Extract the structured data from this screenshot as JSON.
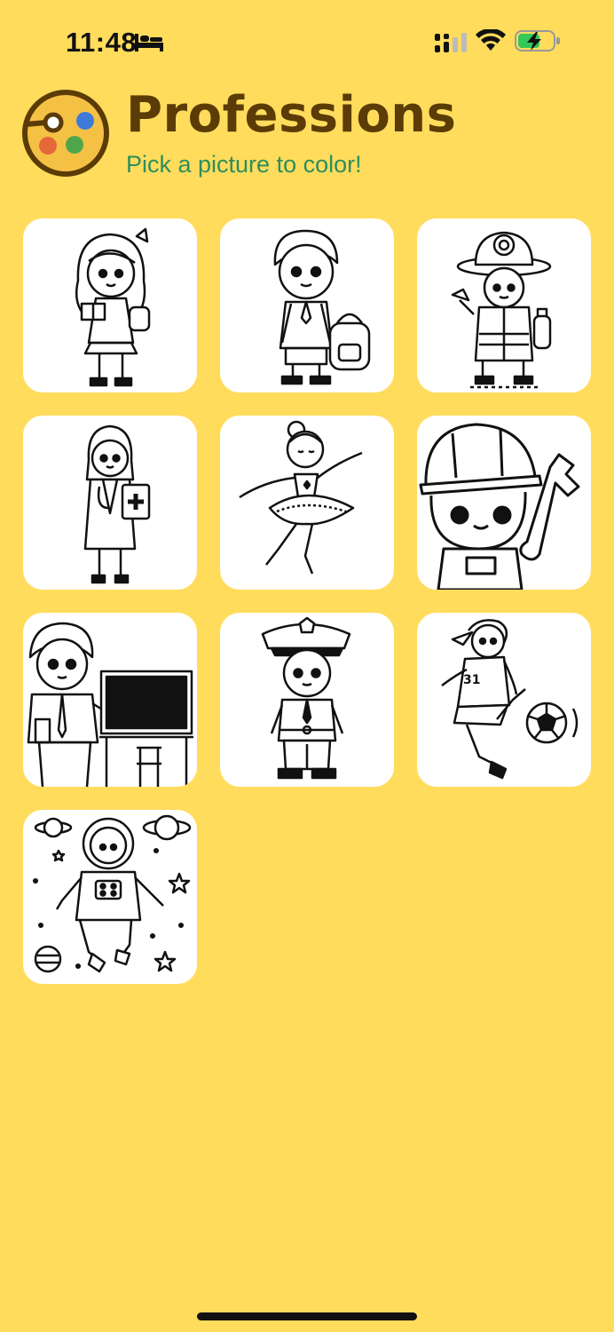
{
  "status_bar": {
    "time": "11:48",
    "icons": [
      "bed-icon",
      "cellular-signal-icon",
      "wifi-icon",
      "battery-charging-icon"
    ],
    "battery_color": "#34C759"
  },
  "header": {
    "title": "Professions",
    "subtitle": "Pick a picture to color!",
    "logo": "paint-palette-icon",
    "title_color": "#5B3B06",
    "subtitle_color": "#2F8E5C"
  },
  "background_color": "#FFDC5C",
  "pictures": [
    {
      "subject": "schoolgirl"
    },
    {
      "subject": "schoolboy"
    },
    {
      "subject": "firefighter"
    },
    {
      "subject": "doctor"
    },
    {
      "subject": "ballerina"
    },
    {
      "subject": "mechanic"
    },
    {
      "subject": "teacher"
    },
    {
      "subject": "police-officer"
    },
    {
      "subject": "soccer-player"
    },
    {
      "subject": "astronaut"
    }
  ]
}
